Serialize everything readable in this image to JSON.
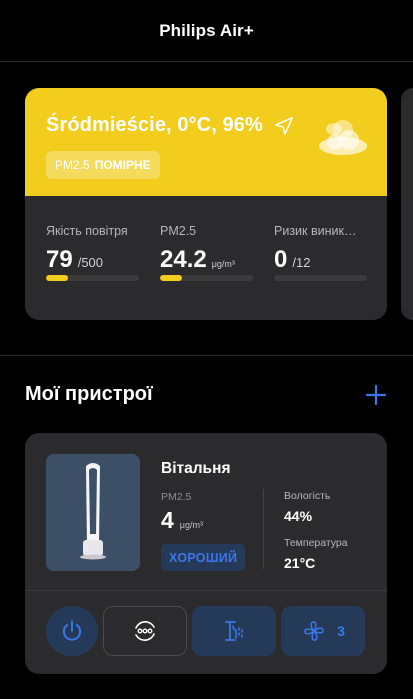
{
  "app": {
    "title": "Philips Air+"
  },
  "air_quality": {
    "location": "Śródmieście, 0°C, 96%",
    "badge": {
      "pollutant": "PM2.5",
      "level": "ПОМІРНЕ"
    },
    "weather_icon": "cloud-icon",
    "metrics": [
      {
        "label": "Якість повітря",
        "value": "79",
        "suffix": "/500",
        "progress": 0.24
      },
      {
        "label": "PM2.5",
        "value": "24.2",
        "suffix": "μg/m³",
        "progress": 0.24
      },
      {
        "label": "Ризик виник…",
        "value": "0",
        "suffix": "/12",
        "progress": 0
      }
    ],
    "colors": {
      "accent": "#f2cd1d",
      "card": "#2b2b2d"
    }
  },
  "devices": {
    "title": "Мої пристрої",
    "add_icon": "plus-icon",
    "items": [
      {
        "name": "Вітальня",
        "pm_label": "PM2.5",
        "pm_value": "4",
        "pm_unit": "μg/m³",
        "quality_label": "ХОРОШИЙ",
        "humidity_label": "Вологість",
        "humidity_value": "44%",
        "temperature_label": "Температура",
        "temperature_value": "21°C",
        "controls": {
          "power_icon": "power-icon",
          "mode_icon": "auto-mode-icon",
          "humidify_icon": "humidifier-icon",
          "fan_icon": "fan-icon",
          "fan_speed": "3"
        }
      }
    ],
    "colors": {
      "active": "#3b77e8",
      "active_bg": "#253a58"
    }
  }
}
